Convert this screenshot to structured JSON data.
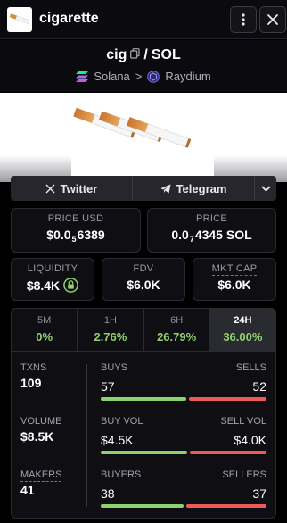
{
  "header": {
    "title": "cigarette",
    "menu_icon": "kebab-menu-icon",
    "close_icon": "close-icon"
  },
  "pair": {
    "base": "cig",
    "separator": "/",
    "quote": "SOL",
    "chain": "Solana",
    "chevron": ">",
    "dex": "Raydium"
  },
  "social": {
    "twitter": "Twitter",
    "telegram": "Telegram"
  },
  "price": {
    "usd_label": "PRICE USD",
    "usd_prefix": "$0.0",
    "usd_zeros": "5",
    "usd_digits": "6389",
    "sol_label": "PRICE",
    "sol_prefix": "0.0",
    "sol_zeros": "7",
    "sol_digits": "4345 SOL"
  },
  "metrics": {
    "liquidity_label": "LIQUIDITY",
    "liquidity_value": "$8.4K",
    "fdv_label": "FDV",
    "fdv_value": "$6.0K",
    "mcap_label": "MKT CAP",
    "mcap_value": "$6.0K"
  },
  "tabs": [
    {
      "label": "5M",
      "value": "0%"
    },
    {
      "label": "1H",
      "value": "2.76%"
    },
    {
      "label": "6H",
      "value": "26.79%"
    },
    {
      "label": "24H",
      "value": "36.00%"
    }
  ],
  "stats": {
    "txns_label": "TXNS",
    "txns_value": "109",
    "volume_label": "VOLUME",
    "volume_value": "$8.5K",
    "makers_label": "MAKERS",
    "makers_value": "41",
    "buys_label": "BUYS",
    "buys_value": "57",
    "sells_label": "SELLS",
    "sells_value": "52",
    "buyvol_label": "BUY VOL",
    "buyvol_value": "$4.5K",
    "sellvol_label": "SELL VOL",
    "sellvol_value": "$4.0K",
    "buyers_label": "BUYERS",
    "buyers_value": "38",
    "sellers_label": "SELLERS",
    "sellers_value": "37"
  },
  "colors": {
    "green": "#8ed16e",
    "red": "#ec5a5a",
    "background": "#000000"
  }
}
